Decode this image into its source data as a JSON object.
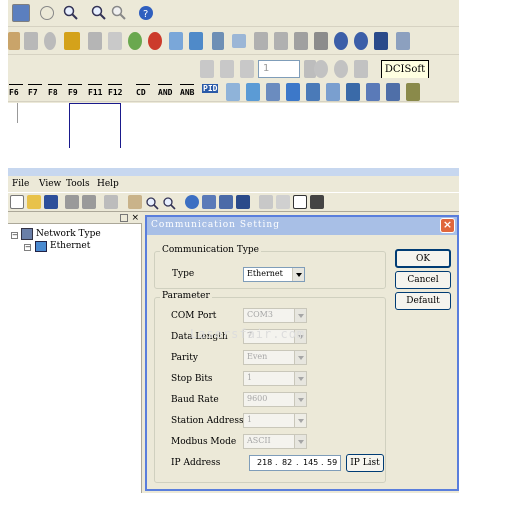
{
  "top_window": {
    "fkeys": [
      "F6",
      "F7",
      "F8",
      "F9",
      "F11",
      "F12"
    ],
    "func_labels": [
      "CD",
      "AND",
      "ANB",
      "PID"
    ],
    "step_value": "1",
    "tooltip": "DCISoft"
  },
  "menu": {
    "items": [
      "File",
      "View",
      "Tools",
      "Help"
    ]
  },
  "tree": {
    "root": "Network Type",
    "child": "Ethernet"
  },
  "dialog": {
    "title": "Communication Setting",
    "comm_type_group": "Communication Type",
    "type_label": "Type",
    "type_value": "Ethernet",
    "param_group": "Parameter",
    "params": [
      {
        "label": "COM Port",
        "value": "COM3",
        "kind": "combo"
      },
      {
        "label": "Data Length",
        "value": "7",
        "kind": "combo"
      },
      {
        "label": "Parity",
        "value": "Even",
        "kind": "combo"
      },
      {
        "label": "Stop Bits",
        "value": "1",
        "kind": "combo"
      },
      {
        "label": "Baud Rate",
        "value": "9600",
        "kind": "combo"
      },
      {
        "label": "Station Address",
        "value": "1",
        "kind": "spin"
      },
      {
        "label": "Modbus Mode",
        "value": "ASCII",
        "kind": "combo"
      }
    ],
    "ip_label": "IP Address",
    "ip_octets": [
      "218",
      "82",
      "145",
      "59"
    ],
    "ip_list_button": "IP List",
    "ok_button": "OK",
    "cancel_button": "Cancel",
    "default_button": "Default"
  },
  "watermark": "Lasersfair.com",
  "colors": {
    "xp_face": "#ece9d8",
    "dialog_title": "#a8bfe6",
    "close_button": "#e0673d",
    "border_blue": "#003c74"
  }
}
